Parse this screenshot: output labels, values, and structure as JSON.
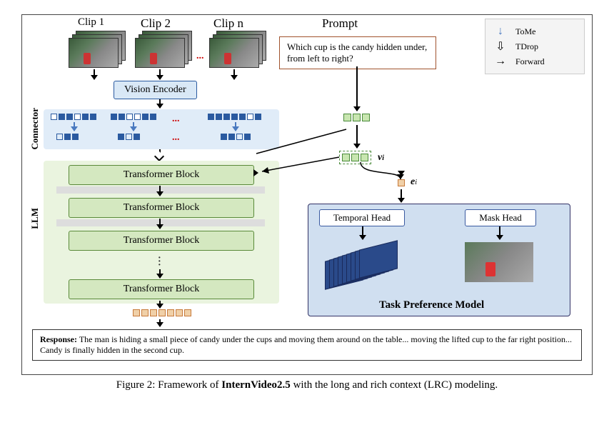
{
  "clips": {
    "l1": "Clip 1",
    "l2": "Clip 2",
    "ln": "Clip n",
    "n_dots": "..."
  },
  "prompt": {
    "title": "Prompt",
    "text": "Which cup is the candy hidden under, from left to right?"
  },
  "legend": {
    "tome": "ToMe",
    "tdrop": "TDrop",
    "forward": "Forward"
  },
  "vision_encoder": "Vision Encoder",
  "connector_label": "Connector",
  "llm_label": "LLM",
  "transformer_block": "Transformer Block",
  "symbols": {
    "vi": "v",
    "vi_sub": "i",
    "ei": "e",
    "ei_sub": "i"
  },
  "tpm": {
    "title": "Task Preference Model",
    "temporal": "Temporal Head",
    "mask": "Mask Head"
  },
  "response": {
    "label": "Response:",
    "text": "The man is hiding a small piece of candy under the cups and moving them around on the table... moving the lifted cup to the far right position... Candy is finally hidden in the second cup."
  },
  "caption": {
    "prefix": "Figure 2: Framework of ",
    "bold": "InternVideo2.5",
    "suffix": " with the long and rich context (LRC) modeling."
  },
  "chart_data": {
    "type": "diagram",
    "description": "Architecture diagram: multiple video clips feed a Vision Encoder; a Connector with ToMe/TDrop token merging/dropping; tokens plus prompt embeddings enter an LLM stack of Transformer Blocks; outputs v_i and e_i feed a Task Preference Model with Temporal Head and Mask Head; final text response below.",
    "arrows": [
      {
        "from": "Clips",
        "to": "Vision Encoder",
        "type": "forward"
      },
      {
        "from": "Vision Encoder",
        "to": "Connector",
        "type": "forward"
      },
      {
        "from": "Connector-tokens",
        "op": "ToMe",
        "type": "blue-down"
      },
      {
        "from": "Connector-merged",
        "op": "TDrop",
        "type": "open-down"
      },
      {
        "from": "Connector",
        "to": "LLM Transformer Block 1",
        "type": "forward"
      },
      {
        "from": "Prompt",
        "to": "prompt-tokens",
        "type": "forward"
      },
      {
        "from": "prompt-tokens v_i",
        "to": "LLM",
        "type": "forward"
      },
      {
        "from": "v_i",
        "to": "e_i",
        "type": "forward"
      },
      {
        "from": "e_i",
        "to": "Temporal Head & Mask Head",
        "type": "forward"
      },
      {
        "from": "LLM output tokens",
        "to": "Response",
        "type": "forward"
      }
    ]
  }
}
